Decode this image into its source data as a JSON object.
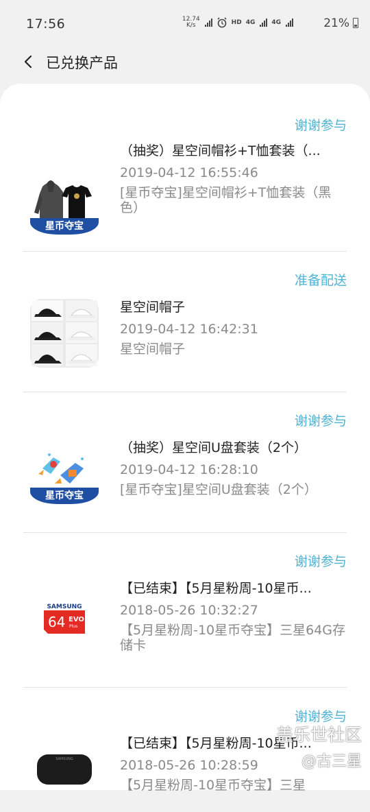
{
  "status_bar": {
    "time": "17:56",
    "net_speed": "12.74\nK/s",
    "hd": "HD",
    "net1": "4G",
    "net2": "4G",
    "battery": "21%"
  },
  "header": {
    "title": "已兑换产品"
  },
  "orders": [
    {
      "status": "谢谢参与",
      "name": "（抽奖）星空间帽衫+T恤套装（...",
      "date": "2019-04-12 16:55:46",
      "desc": "[星币夺宝]星空间帽衫+T恤套装（黑色）",
      "thumb_banner": "星币夺宝",
      "thumb": "hoodie-tshirt"
    },
    {
      "status": "准备配送",
      "name": "星空间帽子",
      "date": "2019-04-12 16:42:31",
      "desc": "星空间帽子",
      "thumb": "caps"
    },
    {
      "status": "谢谢参与",
      "name": "（抽奖）星空间U盘套装（2个）",
      "date": "2019-04-12 16:28:10",
      "desc": "[星币夺宝]星空间U盘套装（2个）",
      "thumb_banner": "星币夺宝",
      "thumb": "usb-rockets"
    },
    {
      "status": "谢谢参与",
      "name": "【已结束】【5月星粉周-10星币...",
      "date": "2018-05-26 10:32:27",
      "desc": "【5月星粉周-10星币夺宝】三星64G存储卡",
      "thumb": "sd-card",
      "card_brand": "SAMSUNG",
      "card_size": "64",
      "card_line": "EVO",
      "card_sub": "Plus"
    },
    {
      "status": "谢谢参与",
      "name": "【已结束】【5月星粉周-10星币...",
      "date": "2018-05-26 10:28:59",
      "desc": "【5月星粉周-10星币夺宝】三星",
      "thumb": "speaker",
      "speaker_brand": "SAMSUNG"
    }
  ],
  "watermark": {
    "site": "盖乐世社区",
    "user": "@古三星"
  },
  "colors": {
    "accent": "#4fb3d4",
    "banner": "#1e4fa3"
  }
}
